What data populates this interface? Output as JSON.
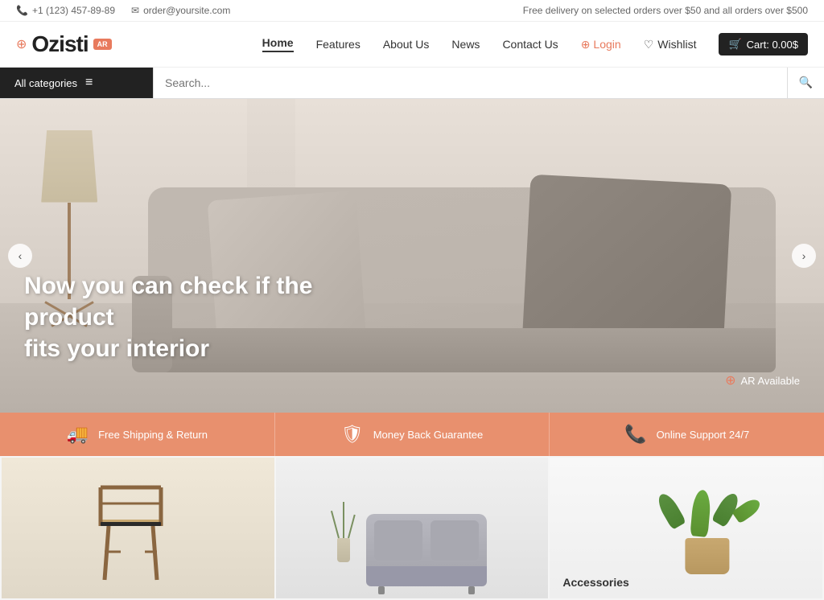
{
  "topbar": {
    "phone": "+1 (123) 457-89-89",
    "email": "order@yoursite.com",
    "promo": "Free delivery on selected orders over $50 and all orders over $500",
    "phone_icon": "📞",
    "email_icon": "✉"
  },
  "header": {
    "logo_text": "Ozisti",
    "logo_ar_badge": "AR",
    "nav": {
      "home": "Home",
      "features": "Features",
      "about_us": "About Us",
      "news": "News",
      "contact_us": "Contact Us",
      "login": "Login",
      "wishlist": "Wishlist",
      "cart": "Cart: 0.00$"
    }
  },
  "searchbar": {
    "all_categories": "All categories",
    "placeholder": "Search..."
  },
  "hero": {
    "headline_line1": "Now you can check if the product",
    "headline_line2": "fits your interior",
    "ar_label": "AR Available",
    "prev_arrow": "‹",
    "next_arrow": "›"
  },
  "features": [
    {
      "icon": "🚚",
      "label": "Free Shipping & Return"
    },
    {
      "icon": "🛡",
      "label": "Money Back Guarantee"
    },
    {
      "icon": "📞",
      "label": "Online Support 24/7"
    }
  ],
  "products": [
    {
      "id": "card1",
      "label": ""
    },
    {
      "id": "card2",
      "label": ""
    },
    {
      "id": "card3",
      "label": "Accessories"
    }
  ]
}
